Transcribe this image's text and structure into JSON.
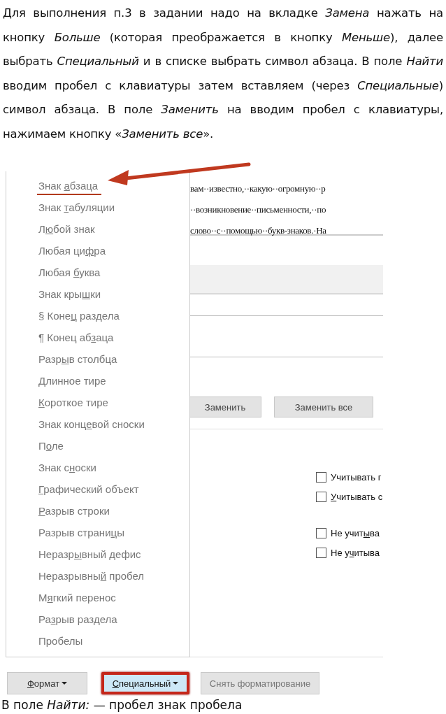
{
  "instructions": "Для выполнения п.3 в задании надо на вкладке *Замена* нажать на кнопку *Больше* (которая преображается в кнопку *Меньше*), далее выбрать *Специальный* и в списке выбрать символ абзаца. В поле *Найти* вводим пробел с клавиатуры затем вставляем (через *Специальные*) символ абзаца. В поле *Заменить* на вводим пробел с клавиатуры, нажимаем кнопку «*Заменить все*».",
  "dialog": {
    "document_lines": [
      "вам··известно,··какую··огромную··р",
      "··возникновение··письменности,··по",
      "слово··с··помощью··букв-знаков.·На"
    ],
    "replace_buttons": [
      "Заменить",
      "Заменить все"
    ],
    "options": [
      {
        "label": {
          "before": "Учитывать г"
        },
        "checked": false
      },
      {
        "label": {
          "key": "У",
          "after": "читывать с"
        },
        "checked": false
      },
      {
        "label": {
          "before": "Не учит",
          "key": "ы",
          "after": "ва"
        },
        "checked": false
      },
      {
        "label": {
          "before": "Не у",
          "key": "ч",
          "after": "итыва"
        },
        "checked": false
      }
    ],
    "bottom_buttons": [
      {
        "label": {
          "key": "Ф",
          "after": "ормат"
        },
        "dropdown": true,
        "highlighted": false
      },
      {
        "label": {
          "key": "С",
          "after": "пециальный"
        },
        "dropdown": true,
        "highlighted": true
      },
      {
        "label": {
          "before": "Снять форматирование"
        },
        "dropdown": false,
        "highlighted": false
      }
    ]
  },
  "special_menu": {
    "items": [
      {
        "label": {
          "before": "Знак ",
          "key": "а",
          "after": "бзаца"
        },
        "marked": true
      },
      {
        "label": {
          "before": "Знак ",
          "key": "т",
          "after": "абуляции"
        },
        "marked": false
      },
      {
        "label": {
          "before": "Л",
          "key": "ю",
          "after": "бой знак"
        },
        "marked": false
      },
      {
        "label": {
          "before": "Любая ци",
          "key": "ф",
          "after": "ра"
        },
        "marked": false
      },
      {
        "label": {
          "before": "Любая ",
          "key": "б",
          "after": "уква"
        },
        "marked": false
      },
      {
        "label": {
          "before": "Знак кры",
          "key": "ш",
          "after": "ки"
        },
        "marked": false
      },
      {
        "label": {
          "before": "§ Коне",
          "key": "ц",
          "after": " раздела"
        },
        "marked": false
      },
      {
        "label": {
          "before": "¶ Конец аб",
          "key": "з",
          "after": "аца"
        },
        "marked": false
      },
      {
        "label": {
          "before": "Разр",
          "key": "ы",
          "after": "в столбца"
        },
        "marked": false
      },
      {
        "label": {
          "key": "Д",
          "after": "линное тире"
        },
        "marked": false
      },
      {
        "label": {
          "key": "К",
          "after": "ороткое тире"
        },
        "marked": false
      },
      {
        "label": {
          "before": "Знак конц",
          "key": "е",
          "after": "вой сноски"
        },
        "marked": false
      },
      {
        "label": {
          "before": "П",
          "key": "о",
          "after": "ле"
        },
        "marked": false
      },
      {
        "label": {
          "before": "Знак с",
          "key": "н",
          "after": "оски"
        },
        "marked": false
      },
      {
        "label": {
          "key": "Г",
          "after": "рафический объект"
        },
        "marked": false
      },
      {
        "label": {
          "key": "Р",
          "after": "азрыв строки"
        },
        "marked": false
      },
      {
        "label": {
          "before": "Разрыв страни",
          "key": "ц",
          "after": "ы"
        },
        "marked": false
      },
      {
        "label": {
          "before": "Неразр",
          "key": "ы",
          "after": "вный дефис"
        },
        "marked": false
      },
      {
        "label": {
          "before": "Неразрывны",
          "key": "й",
          "after": " пробел"
        },
        "marked": false
      },
      {
        "label": {
          "before": "М",
          "key": "я",
          "after": "гкий перенос"
        },
        "marked": false
      },
      {
        "label": {
          "before": "Ра",
          "key": "з",
          "after": "рыв раздела"
        },
        "marked": false
      },
      {
        "label": {
          "before": "Пробелы"
        },
        "marked": false
      }
    ]
  },
  "note": "В поле *Найти:* — пробел знак пробела"
}
